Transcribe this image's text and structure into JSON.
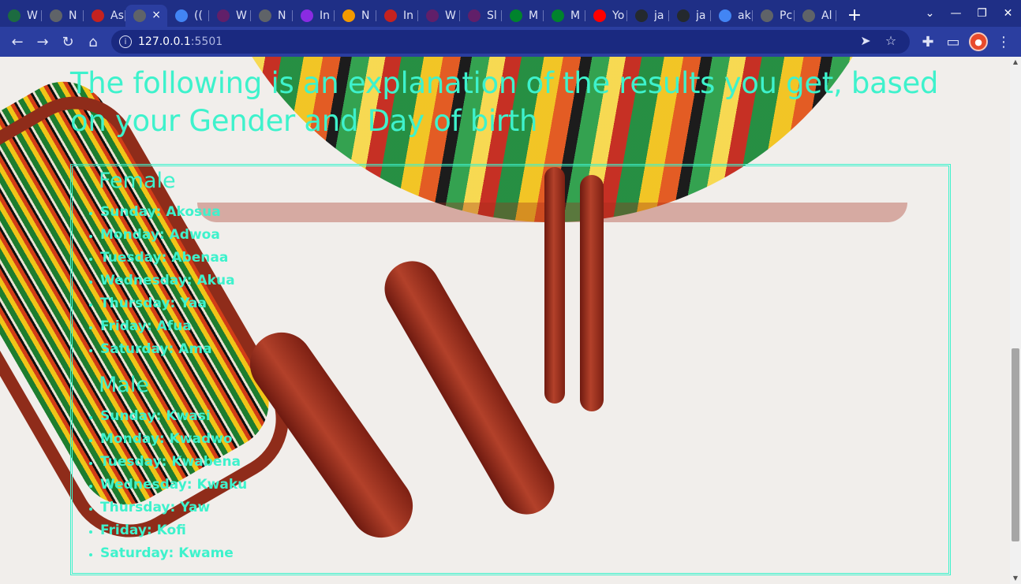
{
  "browser": {
    "tabs": [
      {
        "title": "W",
        "favicon": "tree-icon",
        "color": "#1c6b40"
      },
      {
        "title": "N",
        "favicon": "chrome-icon",
        "color": "#5f6368"
      },
      {
        "title": "As",
        "favicon": "gmail-icon",
        "color": "#c5221f"
      },
      {
        "title": "",
        "favicon": "globe-icon",
        "color": "#5f6368",
        "active": true
      },
      {
        "title": "((",
        "favicon": "google-icon",
        "color": "#4285f4"
      },
      {
        "title": "W",
        "favicon": "slack-icon",
        "color": "#611f69"
      },
      {
        "title": "N",
        "favicon": "chrome-icon",
        "color": "#5f6368"
      },
      {
        "title": "In",
        "favicon": "b-icon",
        "color": "#8a2be2"
      },
      {
        "title": "N",
        "favicon": "infinity-icon",
        "color": "#f29900"
      },
      {
        "title": "In",
        "favicon": "gmail-icon",
        "color": "#c5221f"
      },
      {
        "title": "W",
        "favicon": "slack-icon",
        "color": "#611f69"
      },
      {
        "title": "Sl",
        "favicon": "slack-icon",
        "color": "#611f69"
      },
      {
        "title": "M",
        "favicon": "meet-icon",
        "color": "#00832d"
      },
      {
        "title": "M",
        "favicon": "meet-icon",
        "color": "#00832d"
      },
      {
        "title": "Yo",
        "favicon": "youtube-icon",
        "color": "#ff0000"
      },
      {
        "title": "ja",
        "favicon": "github-icon",
        "color": "#24292e"
      },
      {
        "title": "ja",
        "favicon": "github-icon",
        "color": "#24292e"
      },
      {
        "title": "ak",
        "favicon": "google-icon",
        "color": "#4285f4"
      },
      {
        "title": "Pc",
        "favicon": "globe-icon",
        "color": "#5f6368"
      },
      {
        "title": "Al",
        "favicon": "globe-icon",
        "color": "#5f6368"
      }
    ],
    "new_tab": "+",
    "close_glyph": "×",
    "url_host": "127.0.0.1",
    "url_port": ":5501",
    "profile_initial": "●"
  },
  "page": {
    "heading": "The following is an explanation of the results you get, based on your Gender and Day of birth",
    "female": {
      "title": "Female",
      "names": [
        "Sunday: Akosua",
        "Monday: Adwoa",
        "Tuesday: Abenaa",
        "Wednesday: Akua",
        "Thursday: Yaa",
        "Friday: Afua",
        "Saturday: Ama"
      ]
    },
    "male": {
      "title": "Male",
      "names": [
        "Sunday: Kwasi",
        "Monday: Kwadwo",
        "Tuesday: Kwabena",
        "Wednesday: Kwaku",
        "Thursday: Yaw",
        "Friday: Kofi",
        "Saturday: Kwame"
      ]
    },
    "accent_color": "#3ef2cc"
  }
}
